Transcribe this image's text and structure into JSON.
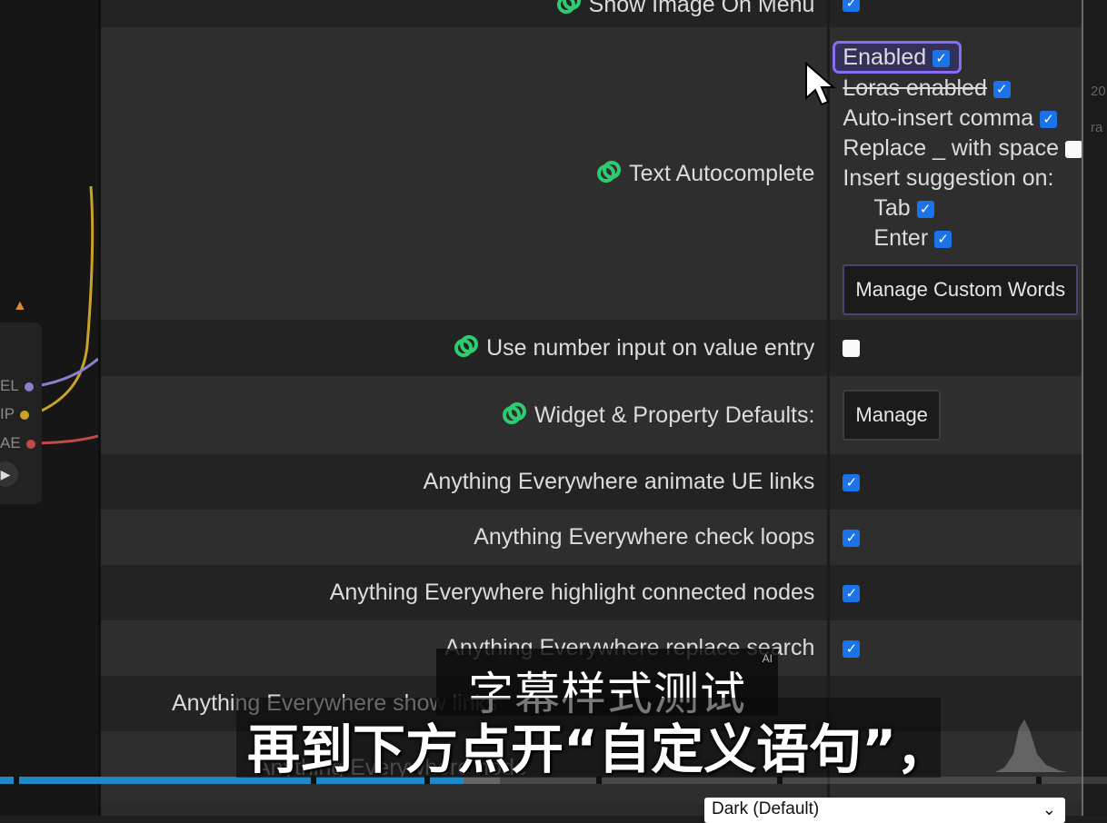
{
  "settings": {
    "show_image_on_menu": "Show Image On Menu",
    "text_autocomplete": {
      "label": "Text Autocomplete",
      "enabled": "Enabled",
      "loras_enabled": "Loras enabled",
      "auto_insert_comma": "Auto-insert comma",
      "replace_underscore": "Replace _ with space",
      "insert_suggestion_on": "Insert suggestion on:",
      "tab": "Tab",
      "enter": "Enter",
      "manage_custom_words": "Manage Custom Words"
    },
    "use_number_input": "Use number input on value entry",
    "widget_defaults": {
      "label": "Widget & Property Defaults:",
      "button": "Manage"
    },
    "ae_animate": "Anything Everywhere animate UE links",
    "ae_check_loops": "Anything Everywhere check loops",
    "ae_highlight": "Anything Everywhere highlight connected nodes",
    "ae_replace_search": "Anything Everywhere replace search",
    "ae_show_links": "Anything Everywhere show links",
    "ae_node_partial": "Anything Everywhere node",
    "theme_select": "Dark (Default)"
  },
  "checkbox_states": {
    "show_image_on_menu": true,
    "enabled": true,
    "loras_enabled": true,
    "auto_insert_comma": true,
    "replace_underscore": false,
    "tab": true,
    "enter": true,
    "use_number_input": false,
    "ae_animate": true,
    "ae_check_loops": true,
    "ae_highlight": true,
    "ae_replace_search": true
  },
  "canvas": {
    "ports": [
      "EL",
      "IP",
      "AE"
    ]
  },
  "right_edge": [
    "20",
    "ra"
  ],
  "overlay": {
    "ai_tag": "AI",
    "subtitle_style_test": "字幕样式测试",
    "subtitle_main": "再到下方点开“自定义语句”，"
  },
  "colors": {
    "accent_green": "#2ecc71",
    "checkbox_blue": "#1a73e8",
    "highlight_purple": "#8a6cf0"
  }
}
